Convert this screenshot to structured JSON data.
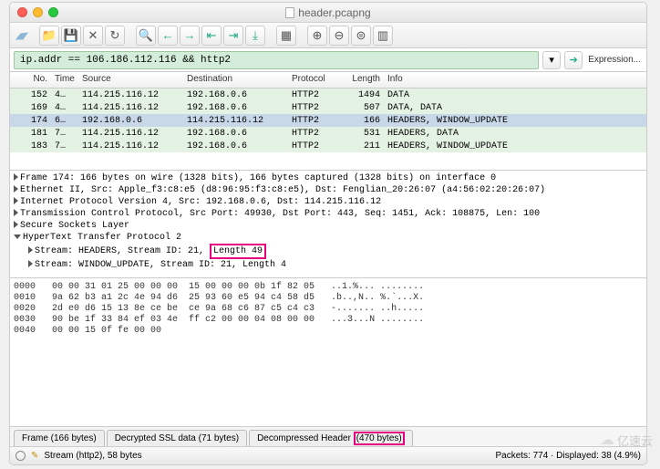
{
  "title": "header.pcapng",
  "filter": "ip.addr == 106.186.112.116 && http2",
  "expression_label": "Expression...",
  "columns": [
    "No.",
    "Time",
    "Source",
    "Destination",
    "Protocol",
    "Length",
    "Info"
  ],
  "packets": [
    {
      "no": "152",
      "time": "4…",
      "src": "114.215.116.12",
      "dst": "192.168.0.6",
      "proto": "HTTP2",
      "len": "1494",
      "info": "DATA",
      "cls": "g"
    },
    {
      "no": "169",
      "time": "4…",
      "src": "114.215.116.12",
      "dst": "192.168.0.6",
      "proto": "HTTP2",
      "len": "507",
      "info": "DATA, DATA",
      "cls": "g"
    },
    {
      "no": "174",
      "time": "6…",
      "src": "192.168.0.6",
      "dst": "114.215.116.12",
      "proto": "HTTP2",
      "len": "166",
      "info": "HEADERS, WINDOW_UPDATE",
      "cls": "sel"
    },
    {
      "no": "181",
      "time": "7…",
      "src": "114.215.116.12",
      "dst": "192.168.0.6",
      "proto": "HTTP2",
      "len": "531",
      "info": "HEADERS, DATA",
      "cls": "g"
    },
    {
      "no": "183",
      "time": "7…",
      "src": "114.215.116.12",
      "dst": "192.168.0.6",
      "proto": "HTTP2",
      "len": "211",
      "info": "HEADERS, WINDOW_UPDATE",
      "cls": "g"
    }
  ],
  "details": {
    "frame": "Frame 174: 166 bytes on wire (1328 bits), 166 bytes captured (1328 bits) on interface 0",
    "eth": "Ethernet II, Src: Apple_f3:c8:e5 (d8:96:95:f3:c8:e5), Dst: Fenglian_20:26:07 (a4:56:02:20:26:07)",
    "ip": "Internet Protocol Version 4, Src: 192.168.0.6, Dst: 114.215.116.12",
    "tcp": "Transmission Control Protocol, Src Port: 49930, Dst Port: 443, Seq: 1451, Ack: 108875, Len: 100",
    "ssl": "Secure Sockets Layer",
    "http2": "HyperText Transfer Protocol 2",
    "stream1_a": "Stream: HEADERS, Stream ID: 21,",
    "stream1_b": "Length 49",
    "stream2": "Stream: WINDOW_UPDATE, Stream ID: 21, Length 4"
  },
  "hex": [
    {
      "off": "0000",
      "b": "00 00 31 01 25 00 00 00  15 00 00 00 0b 1f 82 05",
      "a": "..1.%... ........"
    },
    {
      "off": "0010",
      "b": "9a 62 b3 a1 2c 4e 94 d6  25 93 60 e5 94 c4 58 d5",
      "a": ".b..,N.. %.`...X."
    },
    {
      "off": "0020",
      "b": "2d e0 d6 15 13 8e ce be  ce 9a 68 c6 87 c5 c4 c3",
      "a": "-....... ..h....."
    },
    {
      "off": "0030",
      "b": "90 be 1f 33 84 ef 03 4e  ff c2 00 00 04 08 00 00",
      "a": "...3...N ........"
    },
    {
      "off": "0040",
      "b": "00 00 15 0f fe 00 00",
      "a": ""
    }
  ],
  "tabs": {
    "frame": "Frame (166 bytes)",
    "ssl": "Decrypted SSL data (71 bytes)",
    "decomp_a": "Decompressed Header",
    "decomp_b": "(470 bytes)"
  },
  "status": {
    "left": "Stream (http2), 58 bytes",
    "right": "Packets: 774 · Displayed: 38 (4.9%)"
  },
  "watermark": "亿速云"
}
